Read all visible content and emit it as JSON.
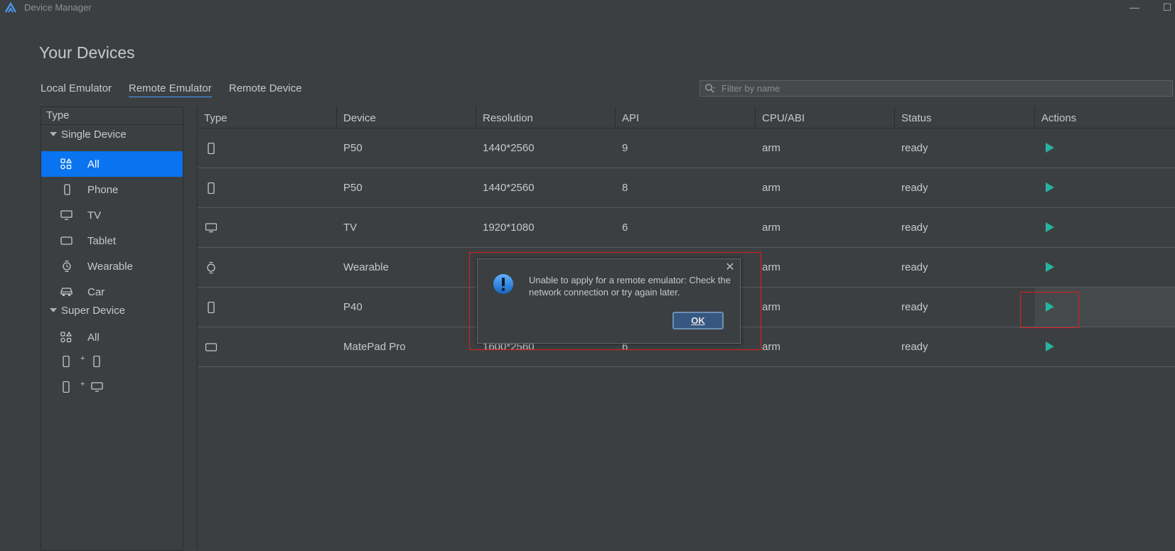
{
  "window": {
    "title": "Device Manager",
    "minimize_glyph": "—",
    "maximize_glyph": "☐"
  },
  "page": {
    "heading": "Your Devices"
  },
  "tabs": [
    {
      "label": "Local Emulator",
      "active": false
    },
    {
      "label": "Remote Emulator",
      "active": true
    },
    {
      "label": "Remote Device",
      "active": false
    }
  ],
  "search": {
    "placeholder": "Filter by name",
    "icon": "search-icon"
  },
  "sidebar": {
    "header": "Type",
    "single_group": "Single Device",
    "single_items": [
      {
        "label": "All",
        "icon": "all-icon",
        "selected": true
      },
      {
        "label": "Phone",
        "icon": "phone-icon",
        "selected": false
      },
      {
        "label": "TV",
        "icon": "tv-icon",
        "selected": false
      },
      {
        "label": "Tablet",
        "icon": "tablet-icon",
        "selected": false
      },
      {
        "label": "Wearable",
        "icon": "watch-icon",
        "selected": false
      },
      {
        "label": "Car",
        "icon": "car-icon",
        "selected": false
      }
    ],
    "super_group": "Super Device",
    "super_items": [
      {
        "label": "All",
        "icon": "all-icon"
      },
      {
        "label": "+",
        "icon": "phone-phone-icon"
      },
      {
        "label": "+",
        "icon": "phone-tv-icon"
      }
    ]
  },
  "table": {
    "columns": [
      "Type",
      "Device",
      "Resolution",
      "API",
      "CPU/ABI",
      "Status",
      "Actions"
    ],
    "rows": [
      {
        "type_icon": "phone-icon",
        "device": "P50",
        "resolution": "1440*2560",
        "api": "9",
        "cpu": "arm",
        "status": "ready",
        "action_icon": "play-icon"
      },
      {
        "type_icon": "phone-icon",
        "device": "P50",
        "resolution": "1440*2560",
        "api": "8",
        "cpu": "arm",
        "status": "ready",
        "action_icon": "play-icon"
      },
      {
        "type_icon": "tv-icon",
        "device": "TV",
        "resolution": "1920*1080",
        "api": "6",
        "cpu": "arm",
        "status": "ready",
        "action_icon": "play-icon"
      },
      {
        "type_icon": "watch-icon",
        "device": "Wearable",
        "resolution": "",
        "api": "",
        "cpu": "arm",
        "status": "ready",
        "action_icon": "play-icon"
      },
      {
        "type_icon": "phone-icon",
        "device": "P40",
        "resolution": "",
        "api": "",
        "cpu": "arm",
        "status": "ready",
        "action_icon": "play-icon"
      },
      {
        "type_icon": "tablet-icon",
        "device": "MatePad Pro",
        "resolution": "1600*2560",
        "api": "6",
        "cpu": "arm",
        "status": "ready",
        "action_icon": "play-icon"
      }
    ]
  },
  "dialog": {
    "icon": "info-icon",
    "message": "Unable to apply for a remote emulator: Check the network connection or try again later.",
    "ok_label": "OK",
    "close_glyph": "✕"
  },
  "colors": {
    "background": "#3c3f41",
    "accent": "#0a74f0",
    "play": "#26b3a0",
    "highlight": "#e01d1d"
  }
}
